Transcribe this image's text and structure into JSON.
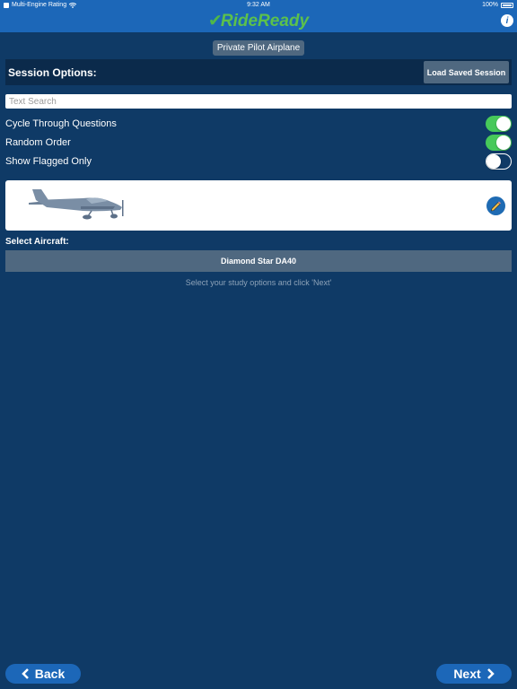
{
  "status_bar": {
    "back_app": "Multi-Engine Rating",
    "time": "9:32 AM",
    "battery": "100%"
  },
  "app": {
    "logo_part1": "Ride",
    "logo_part2": "Ready",
    "info_icon": "info-icon"
  },
  "product": {
    "label": "Private Pilot Airplane"
  },
  "session": {
    "title": "Session Options:",
    "load_label": "Load Saved Session"
  },
  "search": {
    "placeholder": "Text Search",
    "value": ""
  },
  "options": [
    {
      "label": "Cycle Through Questions",
      "on": true
    },
    {
      "label": "Random Order",
      "on": true
    },
    {
      "label": "Show Flagged Only",
      "on": false
    }
  ],
  "aircraft": {
    "image_icon": "airplane-silhouette",
    "edit_icon": "pencil-icon",
    "select_label": "Select Aircraft:",
    "selected": "Diamond Star DA40"
  },
  "hint": "Select your study options and click 'Next'",
  "nav": {
    "back_label": "Back",
    "next_label": "Next"
  },
  "colors": {
    "background": "#0f3a66",
    "topbar": "#1c67b8",
    "button_gray": "#4f6880",
    "toggle_on": "#47c95a",
    "logo_green": "#5cc14c"
  }
}
